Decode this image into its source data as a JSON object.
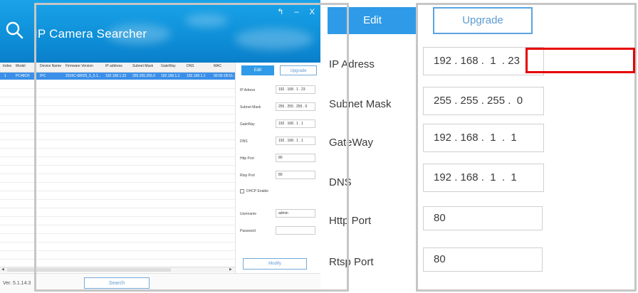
{
  "app": {
    "title": "Camera Searcher",
    "title_prefix": "IP",
    "window_controls": "↰  –  X",
    "version": "Ver. 5.1.14.3",
    "search_button": "Search",
    "modify_button": "Modify",
    "table": {
      "columns": [
        "Index",
        "Model",
        "Device Name",
        "Firmware Version",
        "IP address",
        "Subnet Mask",
        "GateWay",
        "DNS",
        "MAC"
      ],
      "rows": [
        [
          "1",
          "PC48CR",
          "IPC",
          "2016C-68025_5_5.1...",
          "192.168.1.23",
          "255.255.255.0",
          "192.168.1.1",
          "192.168.1.1",
          "00:00:1B:51:..."
        ]
      ]
    },
    "panel": {
      "edit_label": "Edit",
      "upgrade_label": "Upgrade",
      "fields": [
        {
          "label": "IP Adress",
          "value": "192 . 168 . 1 . 23"
        },
        {
          "label": "Subnet Mask",
          "value": "255 . 255 . 255 . 0"
        },
        {
          "label": "GateWay",
          "value": "192 . 168 . 1 . 1"
        },
        {
          "label": "DNS",
          "value": "192 . 168 . 1 . 1"
        },
        {
          "label": "Http Port",
          "value": "80"
        },
        {
          "label": "Rtsp Port",
          "value": "80"
        }
      ],
      "dhcp_label": "DHCP Enable",
      "username_label": "Username",
      "username_value": "admin",
      "password_label": "Password",
      "password_value": ""
    }
  },
  "zoom": {
    "edit_label": "Edit",
    "upgrade_label": "Upgrade",
    "labels": {
      "ip": "IP Adress",
      "subnet": "Subnet Mask",
      "gateway": "GateWay",
      "dns": "DNS",
      "http": "Http Port",
      "rtsp": "Rtsp Port"
    },
    "values": {
      "ip": "192 . 168 .  1  . 23",
      "subnet": "255 . 255 . 255 .  0",
      "gateway": "192 . 168 .  1  .  1",
      "dns": "192 . 168 .  1  .  1",
      "http": "80",
      "rtsp": "80"
    }
  },
  "colors": {
    "header_blue": "#0e8fd8",
    "selected_row": "#3b8fe8",
    "edit_button": "#2f9be8",
    "highlight": "#e50000",
    "frame": "#c6c6c6"
  },
  "icons": {
    "logo": "search-icon"
  }
}
